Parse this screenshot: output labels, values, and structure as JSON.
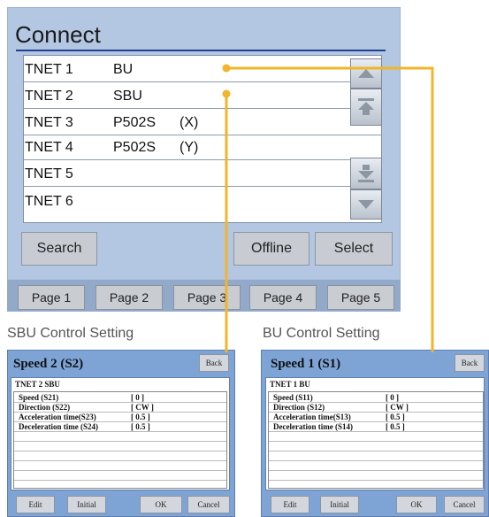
{
  "connect": {
    "title": "Connect",
    "rows": [
      {
        "net": "TNET 1",
        "device": "BU",
        "axis": ""
      },
      {
        "net": "TNET 2",
        "device": "SBU",
        "axis": ""
      },
      {
        "net": "TNET 3",
        "device": "P502S",
        "axis": "(X)"
      },
      {
        "net": "TNET 4",
        "device": "P502S",
        "axis": "(Y)"
      },
      {
        "net": "TNET 5",
        "device": "",
        "axis": ""
      },
      {
        "net": "TNET 6",
        "device": "",
        "axis": ""
      }
    ],
    "buttons": {
      "search": "Search",
      "offline": "Offline",
      "select": "Select"
    },
    "pages": [
      "Page 1",
      "Page 2",
      "Page 3",
      "Page 4",
      "Page 5"
    ]
  },
  "captions": {
    "sbu": "SBU Control Setting",
    "bu": "BU Control Setting"
  },
  "sbu_window": {
    "title": "Speed 2 (S2)",
    "back": "Back",
    "header": "TNET 2 SBU",
    "rows": [
      {
        "k": "Speed (S21)",
        "v": "[ 0 ]"
      },
      {
        "k": "Direction (S22)",
        "v": "[ CW ]"
      },
      {
        "k": "Acceleration time(S23)",
        "v": "[ 0.5 ]"
      },
      {
        "k": "Deceleration time (S24)",
        "v": "[ 0.5 ]"
      }
    ],
    "buttons": {
      "edit": "Edit",
      "initial": "Initial",
      "ok": "OK",
      "cancel": "Cancel"
    }
  },
  "bu_window": {
    "title": "Speed 1 (S1)",
    "back": "Back",
    "header": "TNET 1 BU",
    "rows": [
      {
        "k": "Speed (S11)",
        "v": "[ 0 ]"
      },
      {
        "k": "Direction (S12)",
        "v": "[ CW ]"
      },
      {
        "k": "Acceleration time(S13)",
        "v": "[ 0.5 ]"
      },
      {
        "k": "Deceleration time (S14)",
        "v": "[ 0.5 ]"
      }
    ],
    "buttons": {
      "edit": "Edit",
      "initial": "Initial",
      "ok": "OK",
      "cancel": "Cancel"
    }
  },
  "icons": {
    "scroll_up": "scroll-up-icon",
    "page_up": "page-up-icon",
    "page_down": "page-down-icon",
    "scroll_down": "scroll-down-icon"
  },
  "colors": {
    "callout": "#f0b52a",
    "panel": "#b3c7e3",
    "title_rule": "#1f3f8f"
  }
}
